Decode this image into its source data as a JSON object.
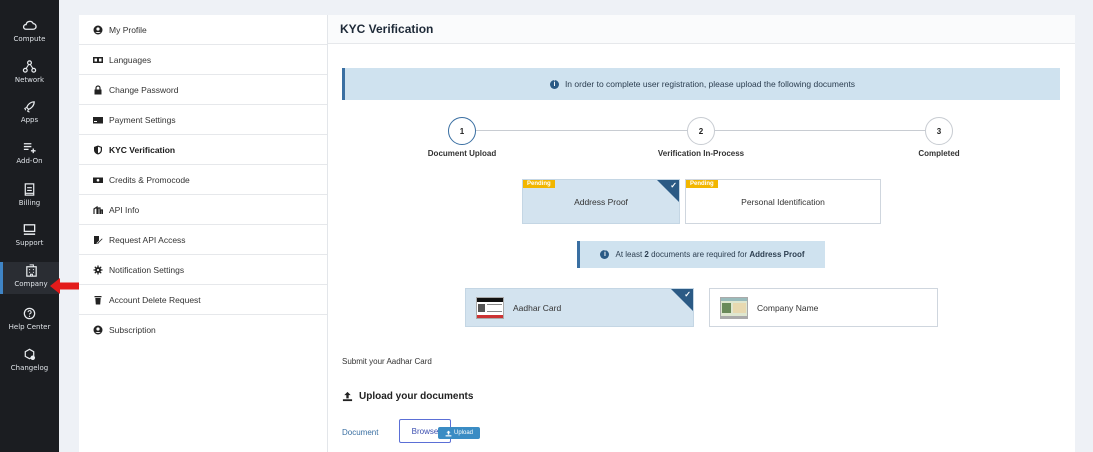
{
  "rail": {
    "items": [
      {
        "label": "Compute",
        "icon": "cloud-icon"
      },
      {
        "label": "Network",
        "icon": "network-icon"
      },
      {
        "label": "Apps",
        "icon": "rocket-icon"
      },
      {
        "label": "Add-On",
        "icon": "list-plus-icon"
      },
      {
        "label": "Billing",
        "icon": "receipt-icon"
      },
      {
        "label": "Support",
        "icon": "chat-icon"
      },
      {
        "label": "Company",
        "icon": "building-icon"
      },
      {
        "label": "Help Center",
        "icon": "question-icon"
      },
      {
        "label": "Changelog",
        "icon": "gear-badge-icon"
      }
    ],
    "active": "Company"
  },
  "menu": {
    "items": [
      {
        "label": "My Profile",
        "icon": "user-circle-icon"
      },
      {
        "label": "Languages",
        "icon": "language-icon"
      },
      {
        "label": "Change Password",
        "icon": "lock-icon"
      },
      {
        "label": "Payment Settings",
        "icon": "card-icon"
      },
      {
        "label": "KYC Verification",
        "icon": "shield-icon"
      },
      {
        "label": "Credits & Promocode",
        "icon": "money-icon"
      },
      {
        "label": "API Info",
        "icon": "api-icon"
      },
      {
        "label": "Request API Access",
        "icon": "edit-doc-icon"
      },
      {
        "label": "Notification Settings",
        "icon": "cog-icon"
      },
      {
        "label": "Account Delete Request",
        "icon": "trash-icon"
      },
      {
        "label": "Subscription",
        "icon": "user-circle-icon"
      }
    ],
    "active": "KYC Verification"
  },
  "panel": {
    "title": "KYC Verification",
    "info_banner": "In order to complete user registration, please upload the following documents",
    "steps": [
      {
        "number": "1",
        "label": "Document Upload",
        "state": "current"
      },
      {
        "number": "2",
        "label": "Verification In-Process",
        "state": "upcoming"
      },
      {
        "number": "3",
        "label": "Completed",
        "state": "upcoming"
      }
    ],
    "doc_tabs": [
      {
        "label": "Address Proof",
        "badge": "Pending",
        "selected": true
      },
      {
        "label": "Personal Identification",
        "badge": "Pending",
        "selected": false
      }
    ],
    "note": {
      "prefix": "At least",
      "count": "2",
      "middle": "documents are required for",
      "target": "Address Proof"
    },
    "cards": [
      {
        "label": "Aadhar Card",
        "selected": true
      },
      {
        "label": "Company Name",
        "selected": false
      }
    ],
    "submit_text": "Submit your Aadhar Card",
    "upload_title": "Upload your documents",
    "document_label": "Document",
    "browse_label": "Browse",
    "upload_label": "Upload"
  },
  "colors": {
    "accent": "#3a6fa2",
    "pending": "#f2b600",
    "annotation_arrow": "#e31b1b"
  }
}
